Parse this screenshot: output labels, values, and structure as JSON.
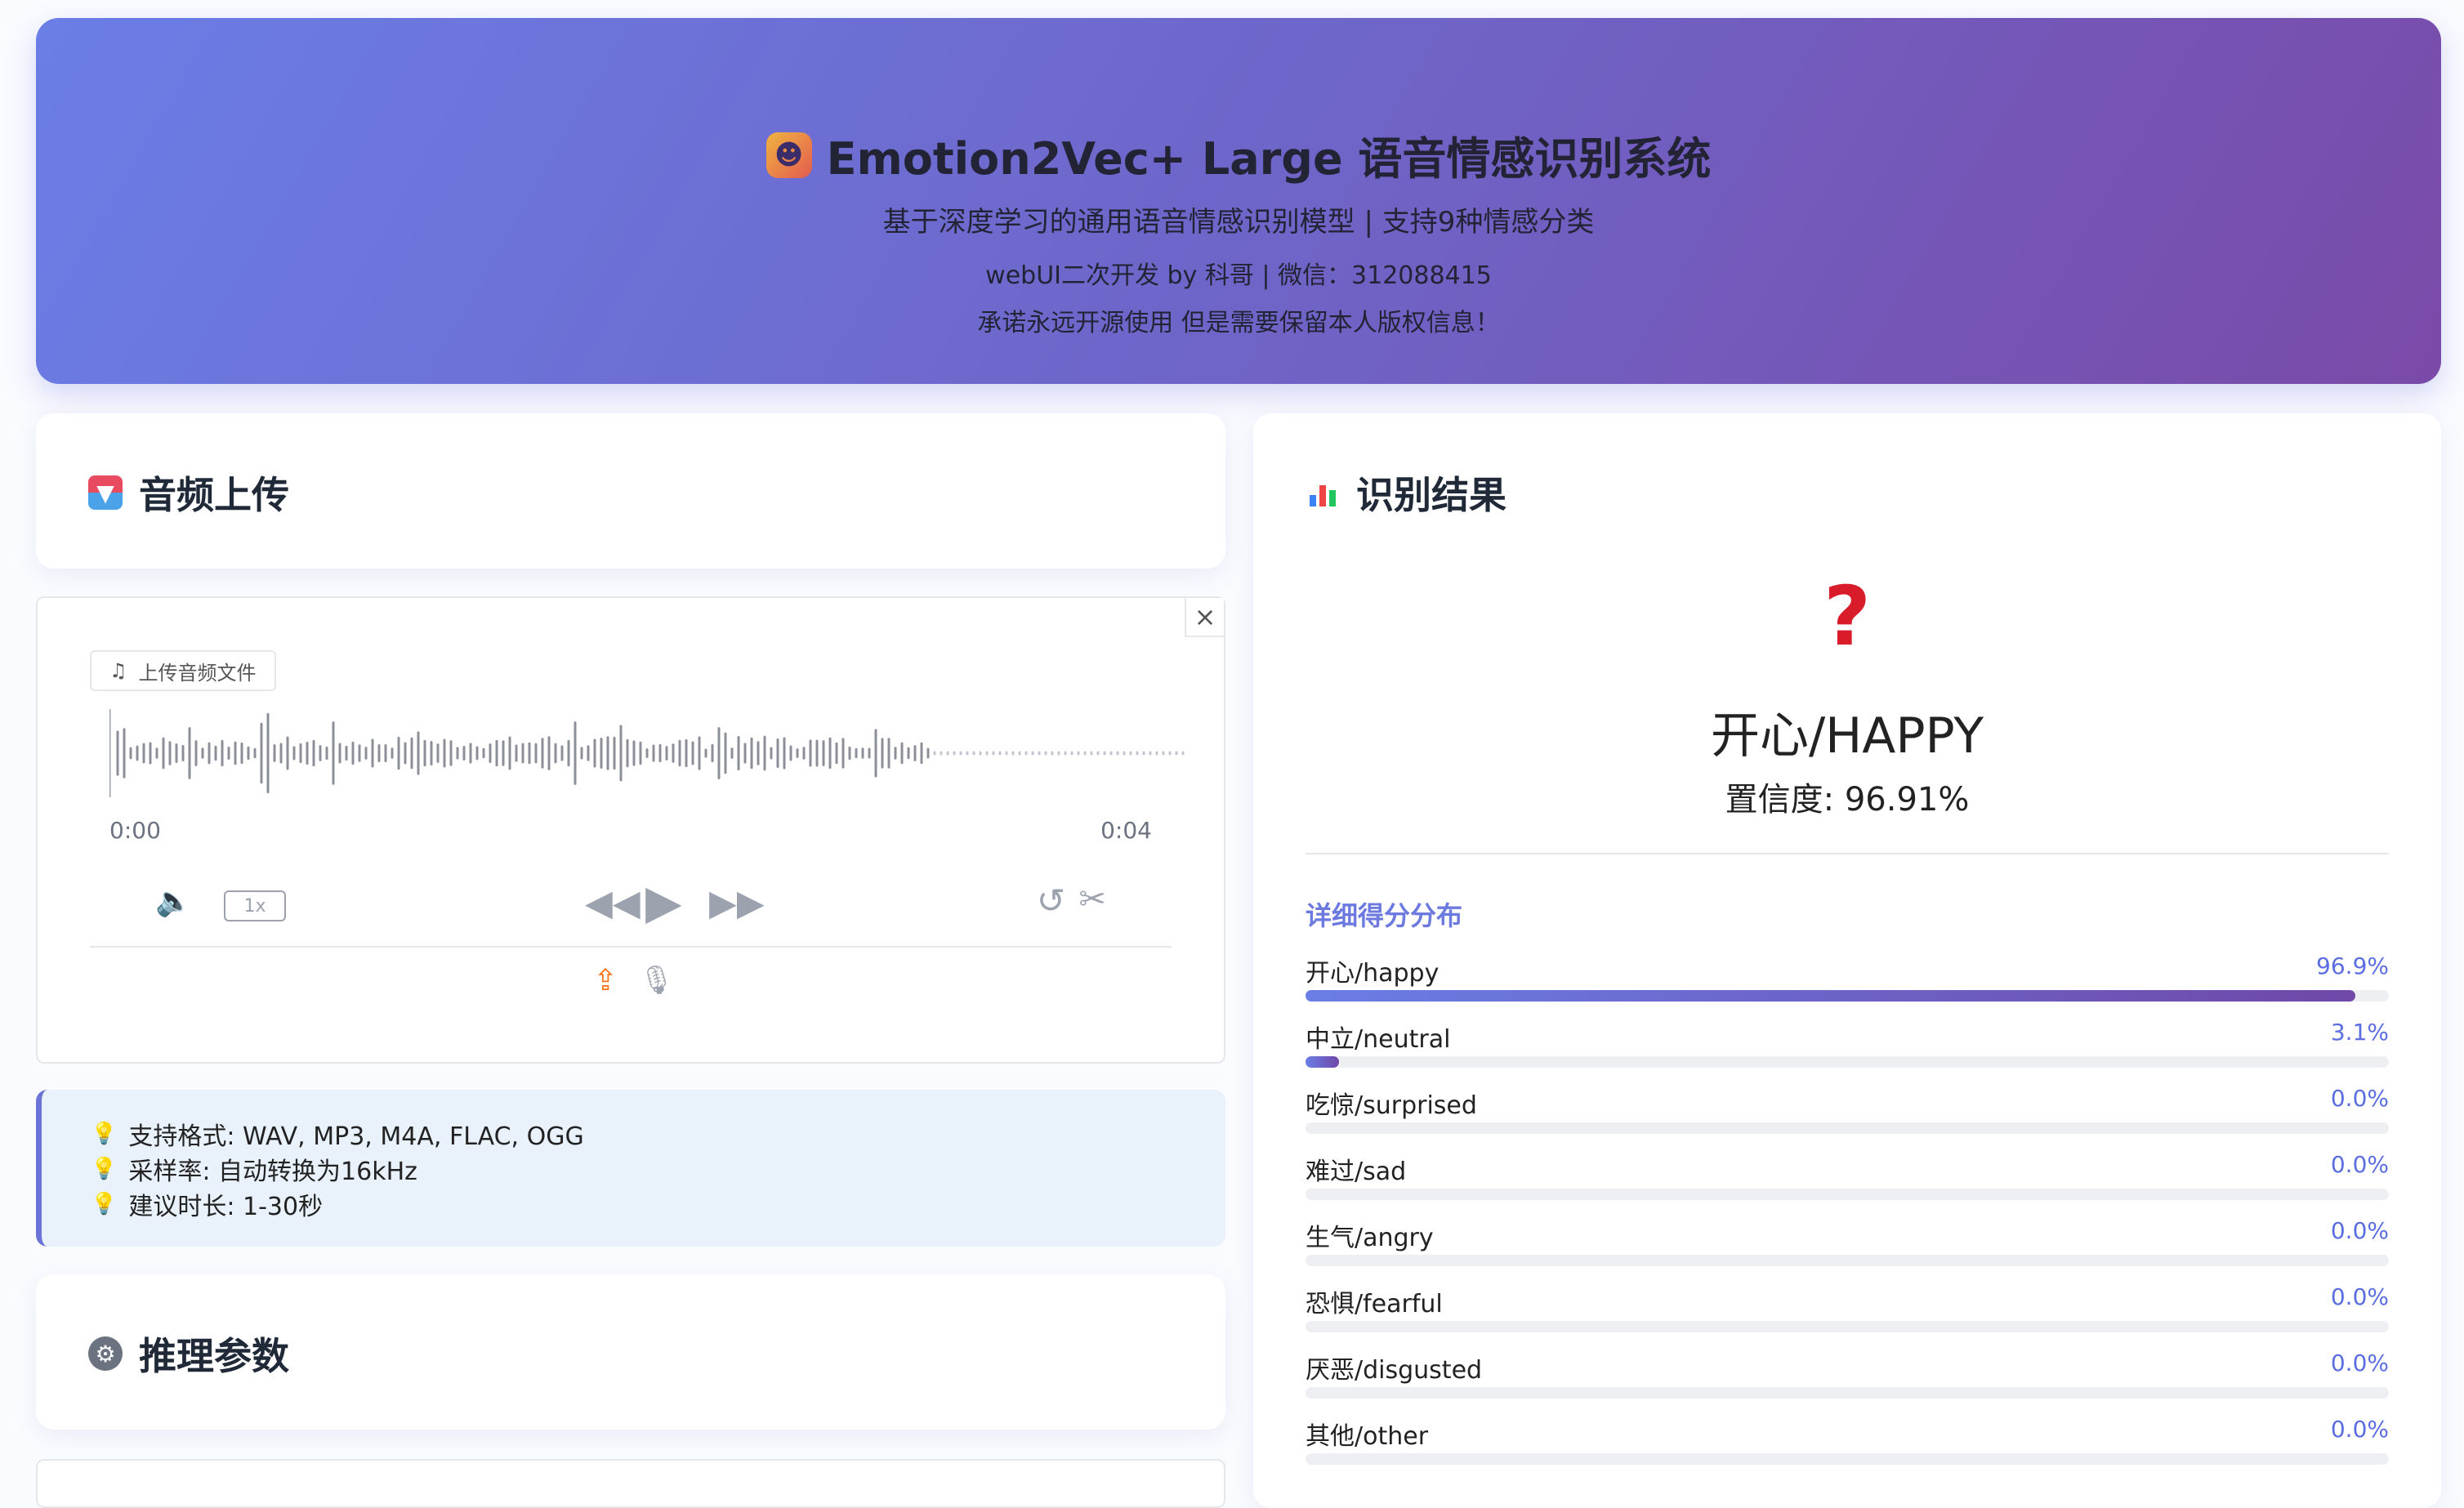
{
  "header": {
    "title": "Emotion2Vec+ Large 语音情感识别系统",
    "subtitle": "基于深度学习的通用语音情感识别模型 | 支持9种情感分类",
    "credit": "webUI二次开发 by 科哥 | 微信：312088415",
    "notice": "承诺永远开源使用 但是需要保留本人版权信息！"
  },
  "upload": {
    "title": "音频上传",
    "label": "上传音频文件",
    "time_start": "0:00",
    "time_end": "0:04",
    "speed": "1x"
  },
  "tips": [
    "支持格式: WAV, MP3, M4A, FLAC, OGG",
    "采样率: 自动转换为16kHz",
    "建议时长: 1-30秒"
  ],
  "inference": {
    "title": "推理参数"
  },
  "result": {
    "title": "识别结果",
    "emoji": "?",
    "label": "开心/HAPPY",
    "confidence": "置信度: 96.91%",
    "dist_title": "详细得分分布",
    "scores": [
      {
        "name": "开心/happy",
        "value": "96.9%",
        "pct": 96.9
      },
      {
        "name": "中立/neutral",
        "value": "3.1%",
        "pct": 3.1
      },
      {
        "name": "吃惊/surprised",
        "value": "0.0%",
        "pct": 0
      },
      {
        "name": "难过/sad",
        "value": "0.0%",
        "pct": 0
      },
      {
        "name": "生气/angry",
        "value": "0.0%",
        "pct": 0
      },
      {
        "name": "恐惧/fearful",
        "value": "0.0%",
        "pct": 0
      },
      {
        "name": "厌恶/disgusted",
        "value": "0.0%",
        "pct": 0
      },
      {
        "name": "其他/other",
        "value": "0.0%",
        "pct": 0
      }
    ]
  },
  "icons": {
    "header": "theater-masks-icon",
    "upload": "inbox-tray-icon",
    "result": "bar-chart-icon",
    "inference": "gear-icon",
    "tip": "light-bulb-icon"
  },
  "colors": {
    "accent": "#6c7ae0",
    "emotion": "#d91c2a",
    "upload_source": "#f97316"
  }
}
